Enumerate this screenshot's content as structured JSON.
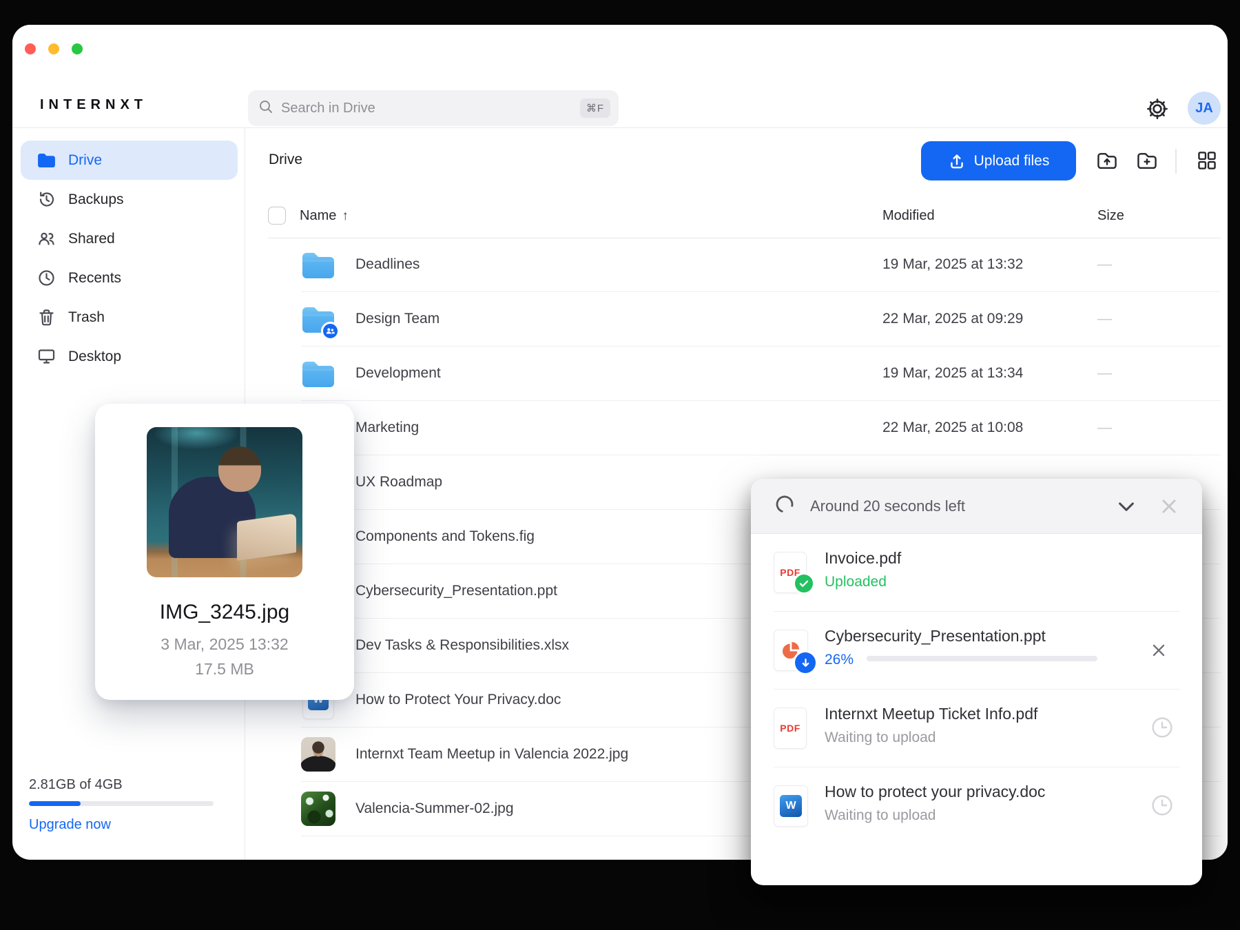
{
  "brand": {
    "logo": "INTERNXT"
  },
  "topbar": {
    "search_placeholder": "Search in Drive",
    "search_shortcut": "⌘F",
    "avatar_initials": "JA"
  },
  "sidebar": {
    "items": [
      {
        "label": "Drive",
        "active": true
      },
      {
        "label": "Backups",
        "active": false
      },
      {
        "label": "Shared",
        "active": false
      },
      {
        "label": "Recents",
        "active": false
      },
      {
        "label": "Trash",
        "active": false
      },
      {
        "label": "Desktop",
        "active": false
      }
    ],
    "storage": {
      "usage_text": "2.81GB of 4GB",
      "used_percent": 28,
      "upgrade_label": "Upgrade now"
    }
  },
  "content": {
    "title": "Drive",
    "toolbar": {
      "upload_button": "Upload files"
    },
    "table": {
      "header": {
        "name": "Name",
        "sort_arrow": "↑",
        "modified": "Modified",
        "size": "Size"
      },
      "rows": [
        {
          "name": "Deadlines",
          "type": "folder",
          "modified": "19 Mar, 2025 at 13:32",
          "size": "—"
        },
        {
          "name": "Design Team",
          "type": "folder-shared",
          "modified": "22 Mar, 2025 at 09:29",
          "size": "—"
        },
        {
          "name": "Development",
          "type": "folder",
          "modified": "19 Mar, 2025 at 13:34",
          "size": "—"
        },
        {
          "name": "Marketing",
          "type": "folder",
          "modified": "22 Mar, 2025 at 10:08",
          "size": "—"
        },
        {
          "name": "UX Roadmap",
          "type": "folder",
          "modified": "",
          "size": ""
        },
        {
          "name": "Components and Tokens.fig",
          "type": "fig",
          "modified": "",
          "size": ""
        },
        {
          "name": "Cybersecurity_Presentation.ppt",
          "type": "ppt",
          "modified": "",
          "size": ""
        },
        {
          "name": "Dev Tasks & Responsibilities.xlsx",
          "type": "xlsx",
          "modified": "",
          "size": ""
        },
        {
          "name": "How to Protect Your Privacy.doc",
          "type": "doc",
          "modified": "",
          "size": ""
        },
        {
          "name": "Internxt Team Meetup in Valencia 2022.jpg",
          "type": "image",
          "modified": "",
          "size": ""
        },
        {
          "name": "Valencia-Summer-02.jpg",
          "type": "image",
          "modified": "",
          "size": ""
        }
      ]
    }
  },
  "preview_card": {
    "filename": "IMG_3245.jpg",
    "date": "3 Mar, 2025 13:32",
    "size": "17.5 MB"
  },
  "upload_toast": {
    "title": "Around 20 seconds left",
    "items": [
      {
        "filename": "Invoice.pdf",
        "status": "Uploaded",
        "state": "uploaded",
        "file_type": "pdf"
      },
      {
        "filename": "Cybersecurity_Presentation.ppt",
        "status": "26%",
        "progress_percent": 26,
        "state": "uploading",
        "file_type": "ppt"
      },
      {
        "filename": "Internxt Meetup Ticket Info.pdf",
        "status": "Waiting to upload",
        "state": "waiting",
        "file_type": "pdf"
      },
      {
        "filename": "How to protect your privacy.doc",
        "status": "Waiting to upload",
        "state": "waiting",
        "file_type": "doc"
      }
    ]
  },
  "colors": {
    "accent_blue": "#1467f3",
    "success_green": "#23c061",
    "folder_blue": "#56b1f0",
    "pdf_red": "#e8392f",
    "ppt_orange": "#ed6c47",
    "word_blue": "#2b7cd3",
    "traffic_lights": [
      "#ff5d55",
      "#febc2e",
      "#28c840"
    ]
  }
}
